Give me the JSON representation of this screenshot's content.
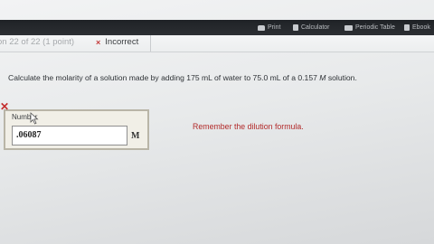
{
  "toolbar": {
    "items": [
      {
        "label": "Print",
        "icon": "printer-icon"
      },
      {
        "label": "Calculator",
        "icon": "calculator-icon"
      },
      {
        "label": "Periodic Table",
        "icon": "periodic-table-icon"
      },
      {
        "label": "Ebook",
        "icon": "ebook-icon"
      }
    ]
  },
  "header": {
    "question_info": "on 22 of 22 (1 point)",
    "status_symbol": "×",
    "status_text": "Incorrect"
  },
  "question": {
    "text_before": "Calculate the molarity of a solution made by adding 175 mL of water to 75.0 mL of a 0.157 ",
    "unit": "M",
    "text_after": " solution."
  },
  "answer": {
    "label": "Number",
    "value": ".06087",
    "unit": "M",
    "wrong_symbol": "✕"
  },
  "feedback": {
    "hint": "Remember the dilution formula."
  },
  "colors": {
    "toolbar_bg": "#2c2f33",
    "incorrect_red": "#c43a3a",
    "hint_red": "#b22a2a",
    "answer_box_bg": "#f1efe7"
  }
}
